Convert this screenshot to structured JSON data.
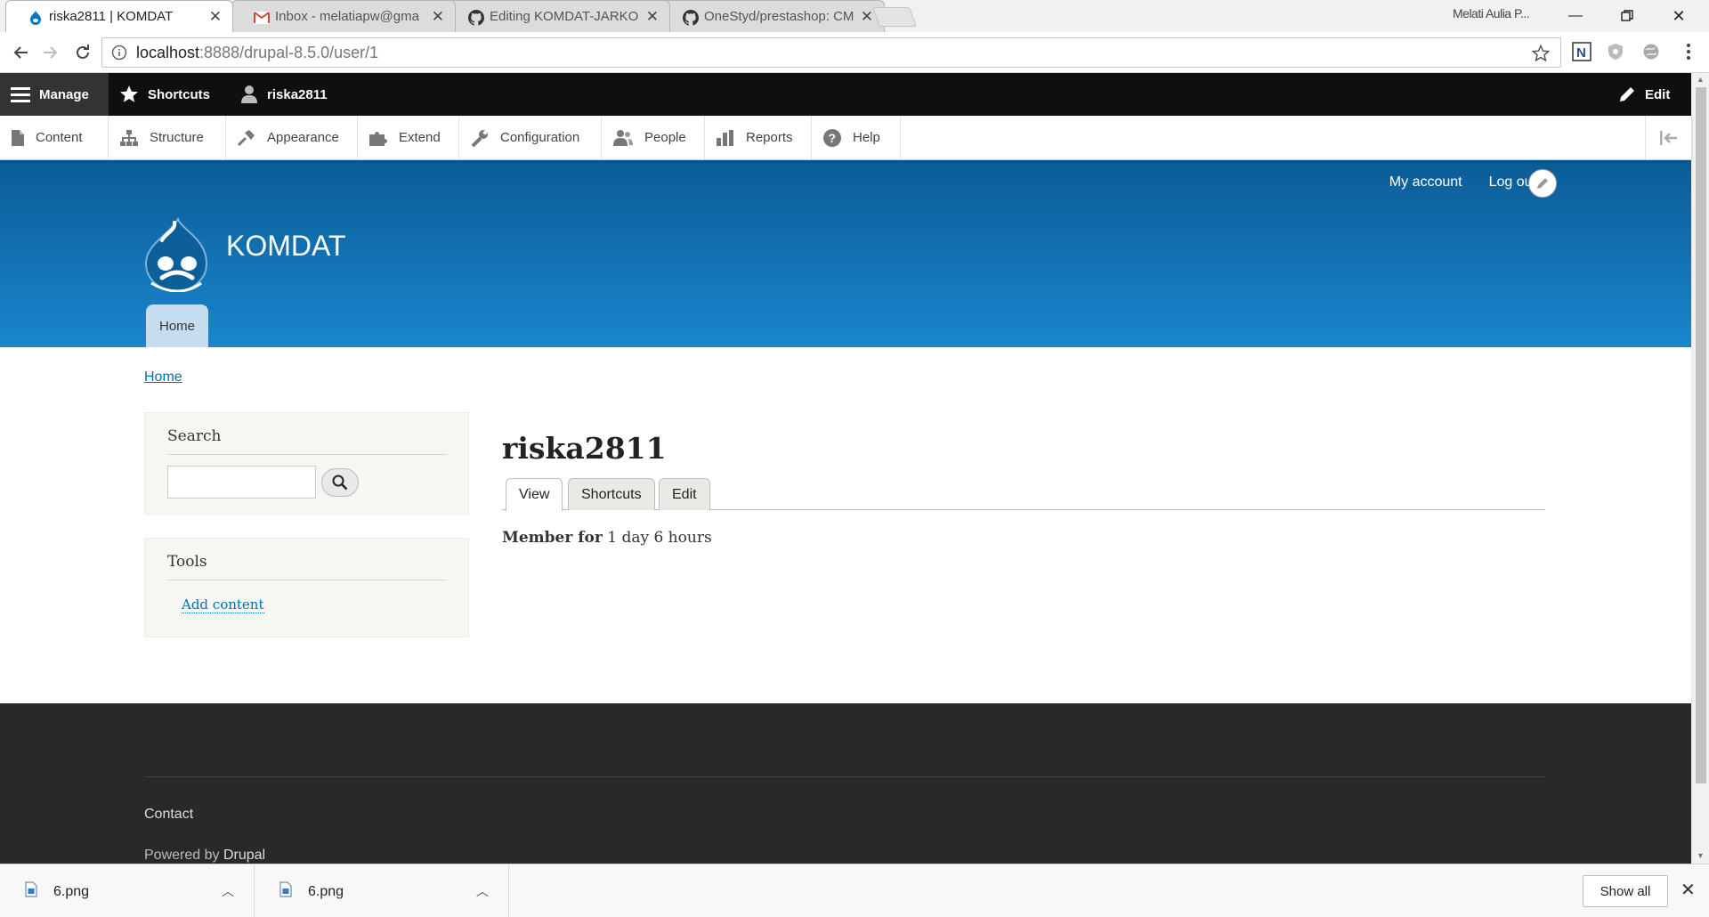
{
  "browser": {
    "tabs": [
      {
        "title": "riska2811 | KOMDAT",
        "icon": "drupal-icon",
        "active": true
      },
      {
        "title": "Inbox - melatiapw@gma",
        "icon": "gmail-icon",
        "active": false
      },
      {
        "title": "Editing KOMDAT-JARKO",
        "icon": "github-icon",
        "active": false
      },
      {
        "title": "OneStyd/prestashop: CM",
        "icon": "github-icon",
        "active": false
      }
    ],
    "profile_name": "Melati Aulia P...",
    "url_host": "localhost",
    "url_rest": ":8888/drupal-8.5.0/user/1"
  },
  "admin_toolbar": {
    "manage": "Manage",
    "shortcuts": "Shortcuts",
    "user": "riska2811",
    "edit": "Edit"
  },
  "admin_tray": [
    {
      "label": "Content",
      "icon": "content-icon"
    },
    {
      "label": "Structure",
      "icon": "structure-icon"
    },
    {
      "label": "Appearance",
      "icon": "appearance-icon"
    },
    {
      "label": "Extend",
      "icon": "extend-icon"
    },
    {
      "label": "Configuration",
      "icon": "configuration-icon"
    },
    {
      "label": "People",
      "icon": "people-icon"
    },
    {
      "label": "Reports",
      "icon": "reports-icon"
    },
    {
      "label": "Help",
      "icon": "help-icon"
    }
  ],
  "header": {
    "secondary_menu": [
      "My account",
      "Log out"
    ],
    "site_name": "KOMDAT",
    "main_menu": [
      "Home"
    ]
  },
  "breadcrumb": [
    "Home"
  ],
  "sidebar": {
    "search_title": "Search",
    "tools_title": "Tools",
    "tools_links": [
      "Add content"
    ]
  },
  "main": {
    "page_title": "riska2811",
    "tasks": [
      "View",
      "Shortcuts",
      "Edit"
    ],
    "member_label": "Member for",
    "member_value": "1 day 6 hours"
  },
  "footer": {
    "contact": "Contact",
    "powered_prefix": "Powered by",
    "powered_link": "Drupal"
  },
  "downloads": {
    "items": [
      "6.png",
      "6.png"
    ],
    "show_all": "Show all"
  },
  "colors": {
    "header_top": "#0b5c97",
    "header_bottom": "#1a86cd",
    "link": "#0071b3",
    "footer_bg": "#292929"
  }
}
